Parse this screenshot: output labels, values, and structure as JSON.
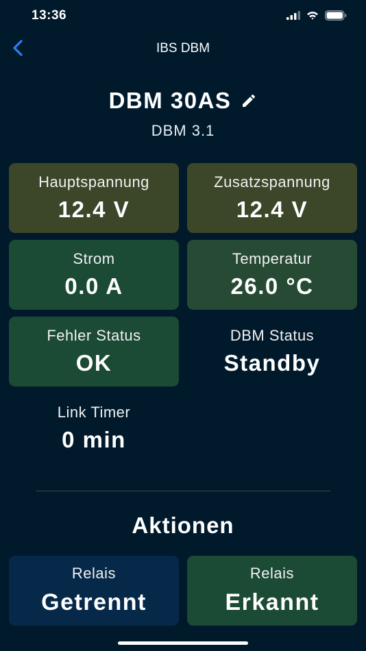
{
  "status_bar": {
    "time": "13:36"
  },
  "nav": {
    "title": "IBS DBM"
  },
  "device": {
    "name": "DBM 30AS",
    "model": "DBM 3.1"
  },
  "readings": {
    "main_voltage": {
      "label": "Hauptspannung",
      "value": "12.4 V"
    },
    "aux_voltage": {
      "label": "Zusatzspannung",
      "value": "12.4 V"
    },
    "current": {
      "label": "Strom",
      "value": "0.0 A"
    },
    "temperature": {
      "label": "Temperatur",
      "value": "26.0 °C"
    },
    "error_status": {
      "label": "Fehler Status",
      "value": "OK"
    },
    "dbm_status": {
      "label": "DBM Status",
      "value": "Standby"
    },
    "link_timer": {
      "label": "Link Timer",
      "value": "0 min"
    }
  },
  "actions": {
    "title": "Aktionen",
    "relay_disconnected": {
      "label": "Relais",
      "value": "Getrennt"
    },
    "relay_detected": {
      "label": "Relais",
      "value": "Erkannt"
    }
  },
  "colors": {
    "background": "#001a2c",
    "olive_tile": "#3c4628",
    "green_tile": "#1b4a35",
    "navy_tile": "#06294a",
    "accent": "#2e7ff0"
  },
  "icons": [
    "back-chevron-icon",
    "edit-pencil-icon",
    "signal-icon",
    "wifi-icon",
    "battery-icon"
  ]
}
